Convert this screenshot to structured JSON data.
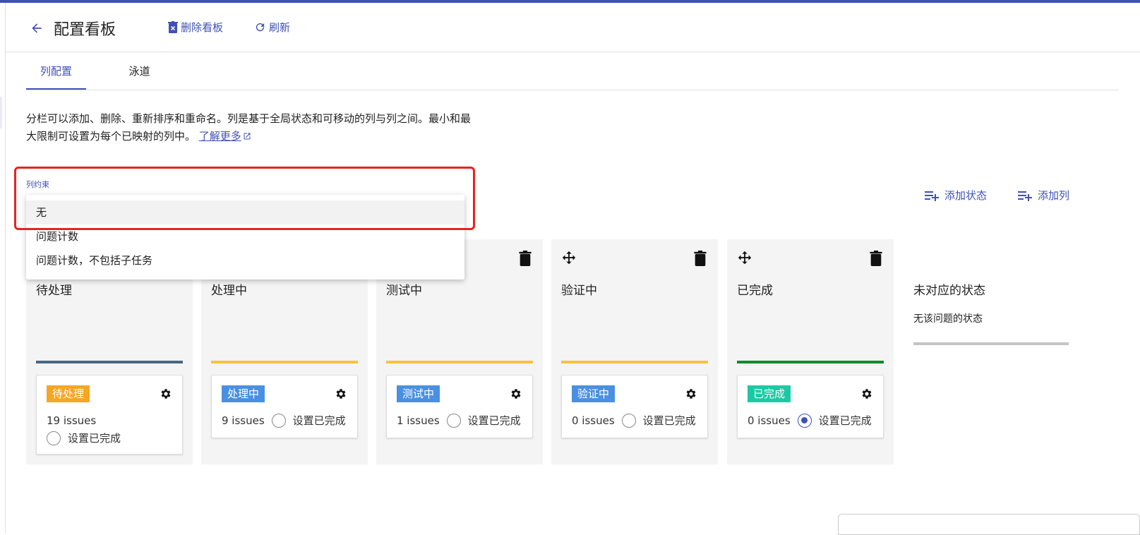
{
  "header": {
    "title": "配置看板",
    "delete_label": "删除看板",
    "refresh_label": "刷新"
  },
  "tabs": [
    {
      "label": "列配置",
      "active": true
    },
    {
      "label": "泳道",
      "active": false
    }
  ],
  "description": {
    "text": "分栏可以添加、删除、重新排序和重命名。列是基于全局状态和可移动的列与列之间。最小和最大限制可设置为每个已映射的列中。",
    "link": "了解更多"
  },
  "constraint": {
    "label": "列约束",
    "options": [
      "无",
      "问题计数",
      "问题计数，不包括子任务"
    ],
    "selected": "无"
  },
  "actions": {
    "add_status": "添加状态",
    "add_column": "添加列"
  },
  "columns": [
    {
      "title": "待处理",
      "bar_color": "#4a6785",
      "status": "待处理",
      "status_color": "#f5a623",
      "issues": "19 issues",
      "done_label": "设置已完成",
      "done_checked": false
    },
    {
      "title": "处理中",
      "bar_color": "#f6c342",
      "status": "处理中",
      "status_color": "#4a90e2",
      "issues": "9 issues",
      "done_label": "设置已完成",
      "done_checked": false
    },
    {
      "title": "测试中",
      "bar_color": "#f6c342",
      "status": "测试中",
      "status_color": "#4a90e2",
      "issues": "1 issues",
      "done_label": "设置已完成",
      "done_checked": false
    },
    {
      "title": "验证中",
      "bar_color": "#f6c342",
      "status": "验证中",
      "status_color": "#4a90e2",
      "issues": "0 issues",
      "done_label": "设置已完成",
      "done_checked": false
    },
    {
      "title": "已完成",
      "bar_color": "#14892c",
      "status": "已完成",
      "status_color": "#1dc9a4",
      "issues": "0 issues",
      "done_label": "设置已完成",
      "done_checked": true
    }
  ],
  "unmapped": {
    "title": "未对应的状态",
    "subtitle": "无该问题的状态"
  }
}
